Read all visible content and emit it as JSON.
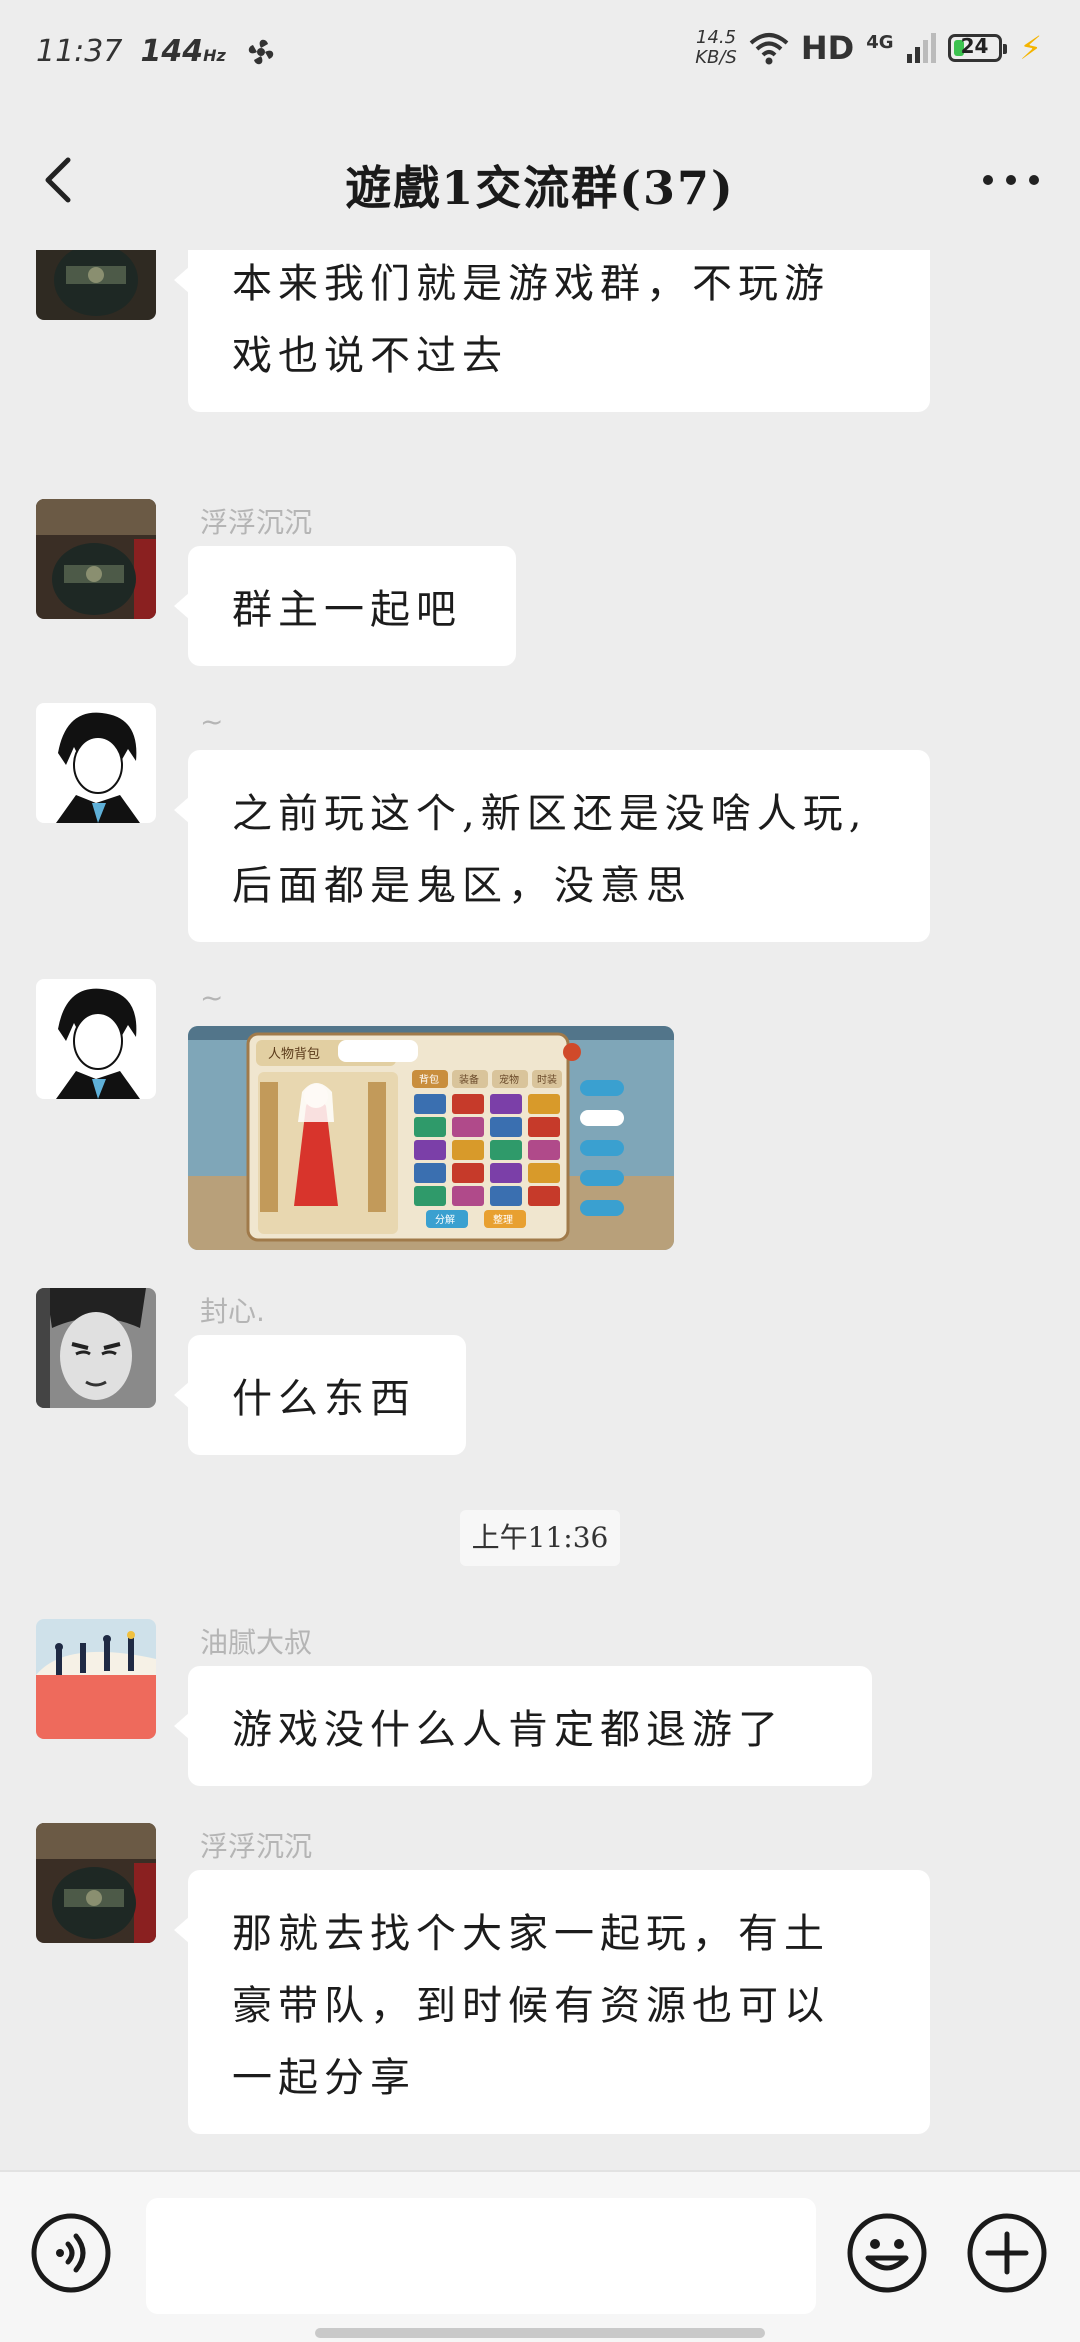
{
  "status_bar": {
    "time": "11:37",
    "refresh": "144",
    "refresh_unit": "Hz",
    "net_speed_value": "14.5",
    "net_speed_unit": "KB/S",
    "hd": "HD",
    "network": "4G",
    "battery": "24",
    "battery_level": 0.24
  },
  "header": {
    "title": "遊戲1交流群(37)"
  },
  "messages": [
    {
      "nickname": "",
      "text_lines": [
        "本来我们就是游戏群，不玩游",
        "戏也说不过去"
      ]
    },
    {
      "nickname": "浮浮沉沉",
      "text_lines": [
        "群主一起吧"
      ]
    },
    {
      "nickname": "~",
      "text_lines": [
        "之前玩这个,新区还是没啥人玩,",
        "后面都是鬼区，没意思"
      ]
    },
    {
      "nickname": "~",
      "image": "game-screenshot",
      "image_text": {
        "panel_title": "人物背包",
        "tab_1": "背包",
        "tab_2": "装备",
        "tab_3": "宠物",
        "tab_4": "时装",
        "btn_1": "分解",
        "btn_2": "整理"
      }
    },
    {
      "nickname": "封心.",
      "text_lines": [
        "什么东西"
      ]
    },
    {
      "nickname": "油腻大叔",
      "text_lines": [
        "游戏没什么人肯定都退游了"
      ]
    },
    {
      "nickname": "浮浮沉沉",
      "text_lines": [
        "那就去找个大家一起玩，有土",
        "豪带队，到时候有资源也可以",
        "一起分享"
      ]
    }
  ],
  "time_separator": "上午11:36",
  "input_bar": {
    "placeholder": ""
  },
  "icons": {
    "back": "chevron-left-icon",
    "more": "more-dots-icon",
    "voice": "voice-icon",
    "emoji": "emoji-icon",
    "plus": "plus-icon"
  },
  "colors": {
    "background": "#ededed",
    "bubble": "#ffffff",
    "nickname": "#b5b5b5",
    "battery_green": "#3cc24f"
  }
}
